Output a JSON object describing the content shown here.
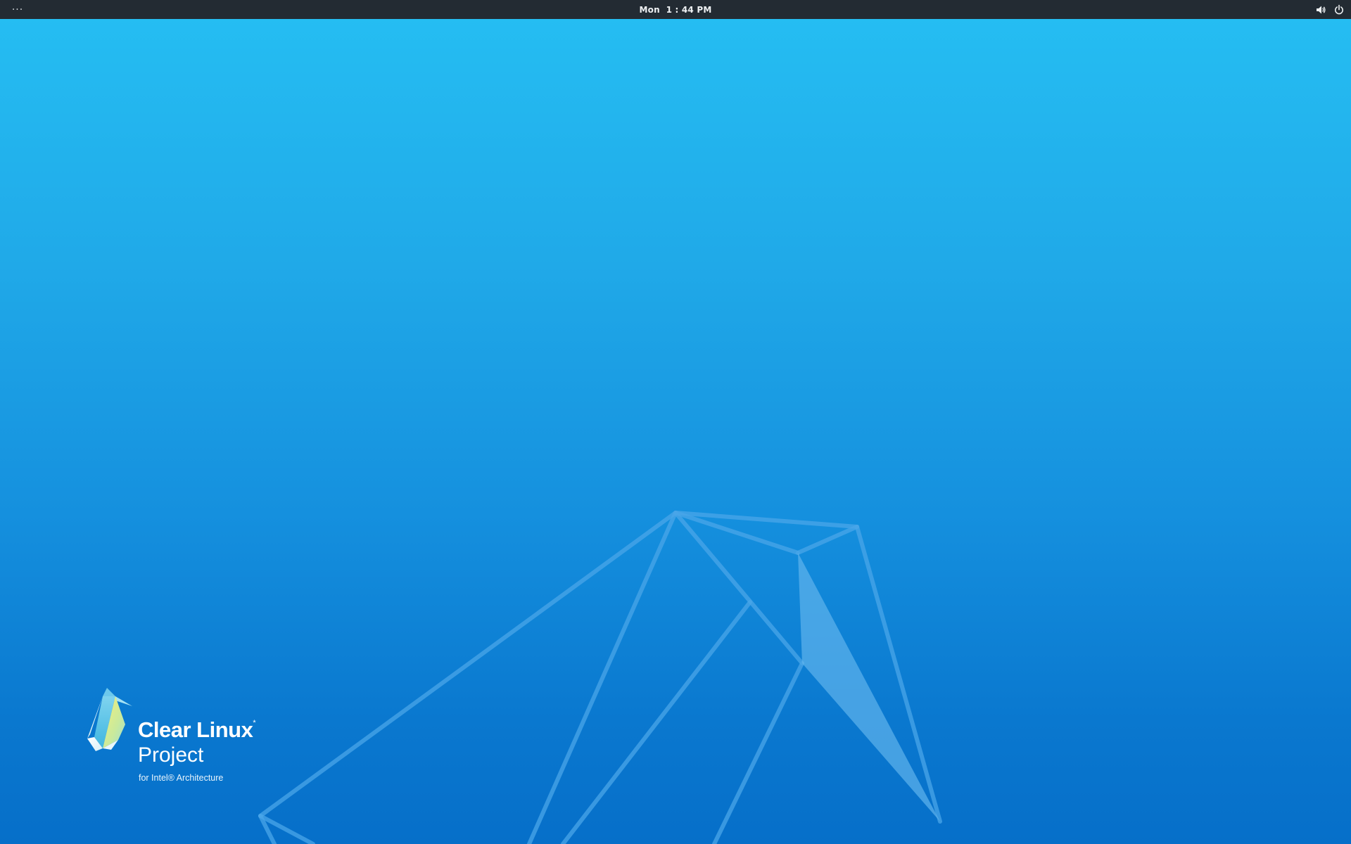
{
  "topbar": {
    "activities_label": "···",
    "clock": "Mon  1 : 44 PM",
    "icons": {
      "volume": "volume-icon",
      "power": "power-icon"
    }
  },
  "desktop": {
    "background_colors": [
      "#25bdf2",
      "#066fc9"
    ],
    "logo": {
      "title": "Clear Linux",
      "title_mark": "*",
      "subtitle": "Project",
      "tagline": "for Intel® Architecture"
    }
  }
}
